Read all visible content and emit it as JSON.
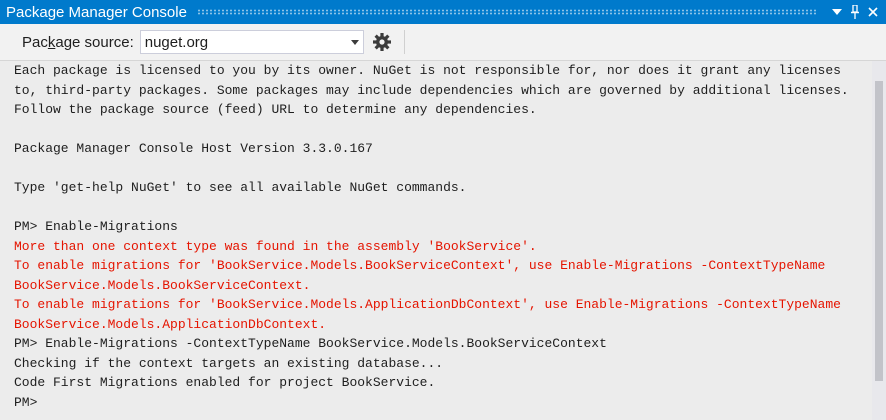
{
  "window": {
    "title": "Package Manager Console",
    "accent_color": "#007acc"
  },
  "title_buttons": [
    {
      "icon": "dropdown-icon"
    },
    {
      "icon": "pin-icon"
    },
    {
      "icon": "close-icon"
    }
  ],
  "toolbar": {
    "source_label_pre": "Pac",
    "source_label_key": "k",
    "source_label_post": "age source:",
    "source_value": "nuget.org",
    "settings_icon": "gear-icon"
  },
  "console": {
    "error_color": "#e51400",
    "lines": [
      {
        "text": "Each package is licensed to you by its owner. NuGet is not responsible for, nor does it grant any licenses",
        "type": "normal"
      },
      {
        "text": "to, third-party packages. Some packages may include dependencies which are governed by additional licenses.",
        "type": "normal"
      },
      {
        "text": "Follow the package source (feed) URL to determine any dependencies.",
        "type": "normal"
      },
      {
        "text": "",
        "type": "normal"
      },
      {
        "text": "Package Manager Console Host Version 3.3.0.167",
        "type": "normal"
      },
      {
        "text": "",
        "type": "normal"
      },
      {
        "text": "Type 'get-help NuGet' to see all available NuGet commands.",
        "type": "normal"
      },
      {
        "text": "",
        "type": "normal"
      },
      {
        "text": "PM> Enable-Migrations",
        "type": "normal"
      },
      {
        "text": "More than one context type was found in the assembly 'BookService'.",
        "type": "error"
      },
      {
        "text": "To enable migrations for 'BookService.Models.BookServiceContext', use Enable-Migrations -ContextTypeName",
        "type": "error"
      },
      {
        "text": "BookService.Models.BookServiceContext.",
        "type": "error"
      },
      {
        "text": "To enable migrations for 'BookService.Models.ApplicationDbContext', use Enable-Migrations -ContextTypeName",
        "type": "error"
      },
      {
        "text": "BookService.Models.ApplicationDbContext.",
        "type": "error"
      },
      {
        "text": "PM> Enable-Migrations -ContextTypeName BookService.Models.BookServiceContext",
        "type": "normal"
      },
      {
        "text": "Checking if the context targets an existing database...",
        "type": "normal"
      },
      {
        "text": "Code First Migrations enabled for project BookService.",
        "type": "normal"
      },
      {
        "text": "PM>",
        "type": "normal"
      }
    ]
  }
}
